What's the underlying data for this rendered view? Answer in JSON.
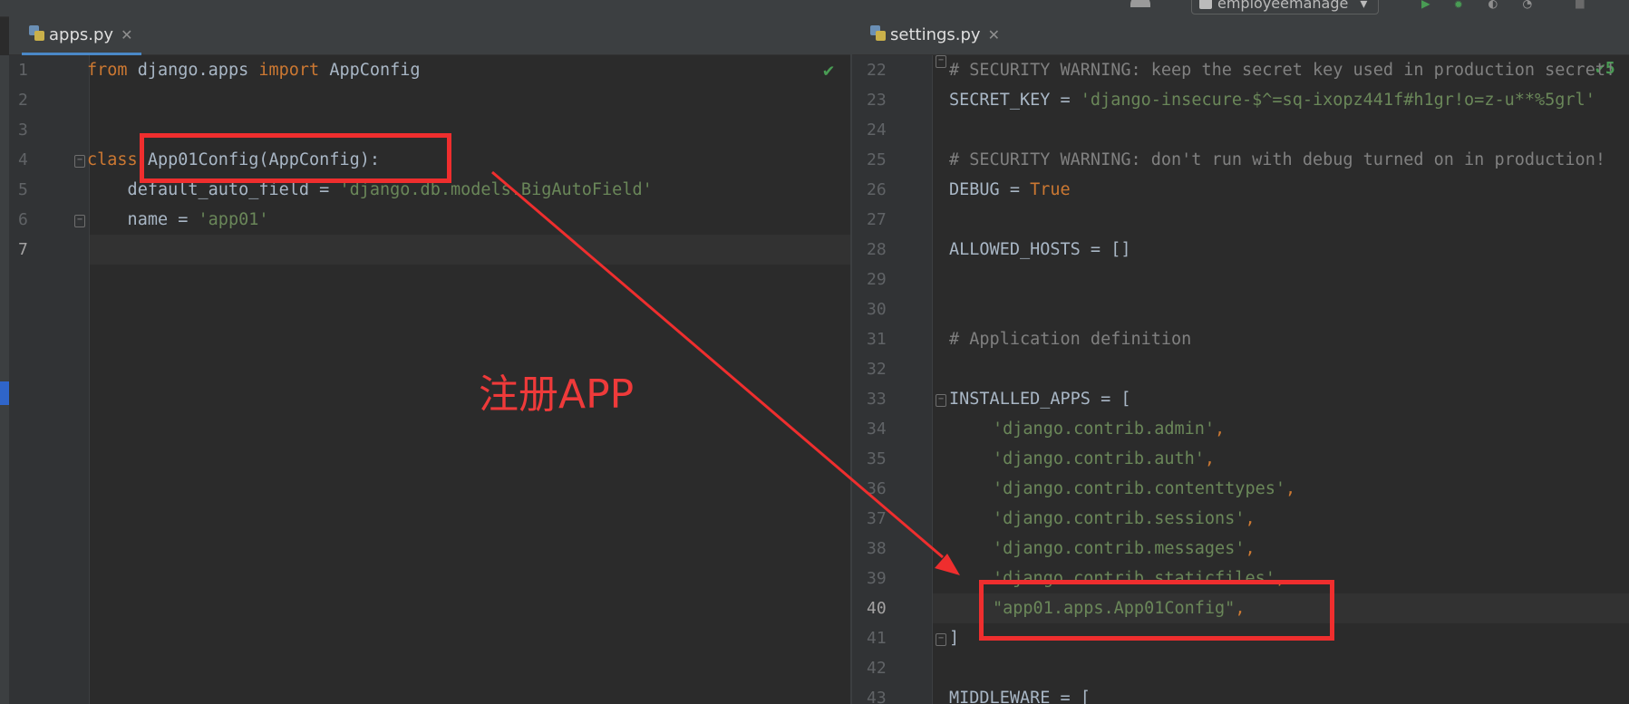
{
  "toolbar": {
    "project_selector": "employeemanage",
    "dropdown_glyph": "▾"
  },
  "left_tab": {
    "name": "apps.py",
    "close_glyph": "✕"
  },
  "right_tab": {
    "name": "settings.py",
    "close_glyph": "✕"
  },
  "left_editor": {
    "line_numbers": [
      "1",
      "2",
      "3",
      "4",
      "5",
      "6",
      "7"
    ],
    "inspection_status": "✔",
    "lines": {
      "l1_from": "from",
      "l1_mod": " django.apps ",
      "l1_import": "import",
      "l1_name": " AppConfig",
      "l4_class": "class",
      "l4_rest": " App01Config(AppConfig):",
      "l5_name": "    default_auto_field = ",
      "l5_str": "'django.db.models.BigAutoField'",
      "l6_name": "    name = ",
      "l6_str": "'app01'"
    }
  },
  "right_editor": {
    "line_numbers": [
      "22",
      "23",
      "24",
      "25",
      "26",
      "27",
      "28",
      "29",
      "30",
      "31",
      "32",
      "33",
      "34",
      "35",
      "36",
      "37",
      "38",
      "39",
      "40",
      "41",
      "42",
      "43"
    ],
    "inspection_status": "✔5",
    "lines": {
      "l22": "# SECURITY WARNING: keep the secret key used in production secret!",
      "l23_name": "SECRET_KEY = ",
      "l23_str": "'django-insecure-$^=sq-ixopz441f#h1gr!o=z-u**%5grl'",
      "l25": "# SECURITY WARNING: don't run with debug turned on in production!",
      "l26_name": "DEBUG = ",
      "l26_val": "True",
      "l28": "ALLOWED_HOSTS = []",
      "l31": "# Application definition",
      "l33": "INSTALLED_APPS = [",
      "l34": "'django.contrib.admin'",
      "l35": "'django.contrib.auth'",
      "l36": "'django.contrib.contenttypes'",
      "l37": "'django.contrib.sessions'",
      "l38": "'django.contrib.messages'",
      "l39": "'django.contrib.staticfiles'",
      "l40": "\"app01.apps.App01Config\"",
      "comma": ",",
      "l41": "]",
      "l43": "MIDDLEWARE = ["
    }
  },
  "annotation": {
    "text": "注册APP",
    "color": "#ef2e2e"
  },
  "colors": {
    "keyword": "#cc7832",
    "string": "#6a8759",
    "comment": "#808080",
    "plain": "#a9b7c6",
    "background": "#2b2b2b",
    "tab_underline": "#4a88c7"
  }
}
